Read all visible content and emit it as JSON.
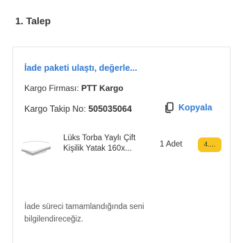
{
  "section": {
    "title": "1. Talep"
  },
  "return_card": {
    "status_link": "İade paketi ulaştı, değerle...",
    "cargo_firm_label": "Kargo Firması:",
    "cargo_firm_value": "PTT Kargo",
    "tracking_label": "Kargo Takip No:",
    "tracking_value": "505035064",
    "copy_icon": "copy-icon",
    "copy_label": "Kopyala",
    "product": {
      "name": "Lüks Torba Yaylı Çift Kişilik Yatak 160x...",
      "quantity": "1 Adet",
      "price": "4...."
    },
    "notice": "İade süreci tamamlandığında seni bilgilendireceğiz."
  },
  "colors": {
    "link": "#2f7ad1",
    "badge": "#f7c51e",
    "border": "#e6e6e6"
  }
}
